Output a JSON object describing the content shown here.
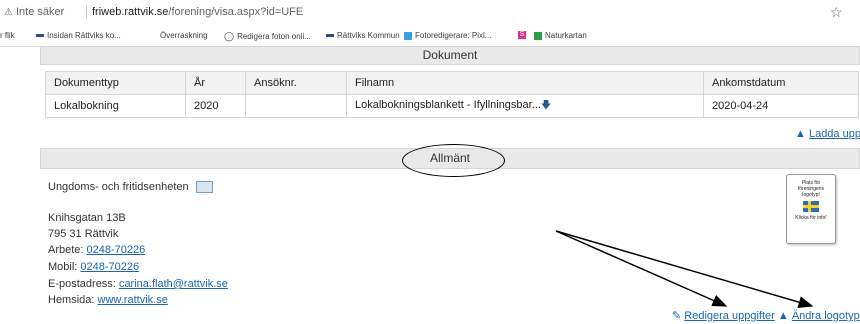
{
  "address_bar": {
    "security_label": "Inte säker",
    "url_host": "friweb.rattvik.se",
    "url_path": "/forening/visa.aspx?id=UFE"
  },
  "bookmarks": [
    {
      "label": "r flik",
      "icon": "none",
      "color": ""
    },
    {
      "label": "Insidan Rättviks ko...",
      "icon": "rattvik-logo-icon",
      "color": "#2a4b8d"
    },
    {
      "label": "Överraskning",
      "icon": "none",
      "color": ""
    },
    {
      "label": "Redigera foton onli...",
      "icon": "camera-icon",
      "color": "#5f6368"
    },
    {
      "label": "Rättviks Kommun",
      "icon": "rattvik-logo-icon",
      "color": "#2a4b8d"
    },
    {
      "label": "Fotoredigerare: Pixl...",
      "icon": "pixlr-icon",
      "color": "#3aa0e0"
    },
    {
      "label": "S",
      "icon": "s-square-icon",
      "color": "#d63384"
    },
    {
      "label": "Naturkartan",
      "icon": "naturkartan-icon",
      "color": "#2e9b45"
    }
  ],
  "sections": {
    "documents_title": "Dokument",
    "general_title": "Allmänt"
  },
  "documents_table": {
    "headers": [
      "Dokumenttyp",
      "År",
      "Ansöknr.",
      "Filnamn",
      "Ankomstdatum"
    ],
    "rows": [
      [
        "Lokalbokning",
        "2020",
        "",
        "Lokalbokningsblankett - Ifyllningsbar...",
        "2020-04-24"
      ]
    ]
  },
  "upload_link": "Ladda upp",
  "organization": {
    "name": "Ungdoms- och fritidsenheten",
    "address_line1": "Knihsgatan 13B",
    "address_line2": "795 31 Rättvik",
    "work_label": "Arbete:",
    "work_phone": "0248-70226",
    "mobile_label": "Mobil:",
    "mobile_phone": "0248-70226",
    "email_label": "E-postadress:",
    "email": "carina.flath@rattvik.se",
    "website_label": "Hemsida:",
    "website": "www.rattvik.se"
  },
  "logo_placeholder": {
    "line1": "Plats för",
    "line2": "föreningens",
    "line3": "logotyp!",
    "line4": "Klicka för info!"
  },
  "actions": {
    "edit_details": "Redigera uppgifter",
    "change_logo": "Ändra logotyp"
  },
  "colors": {
    "link": "#1a66b0",
    "header_bg": "#e9e9e9",
    "annotation": "#000000"
  }
}
